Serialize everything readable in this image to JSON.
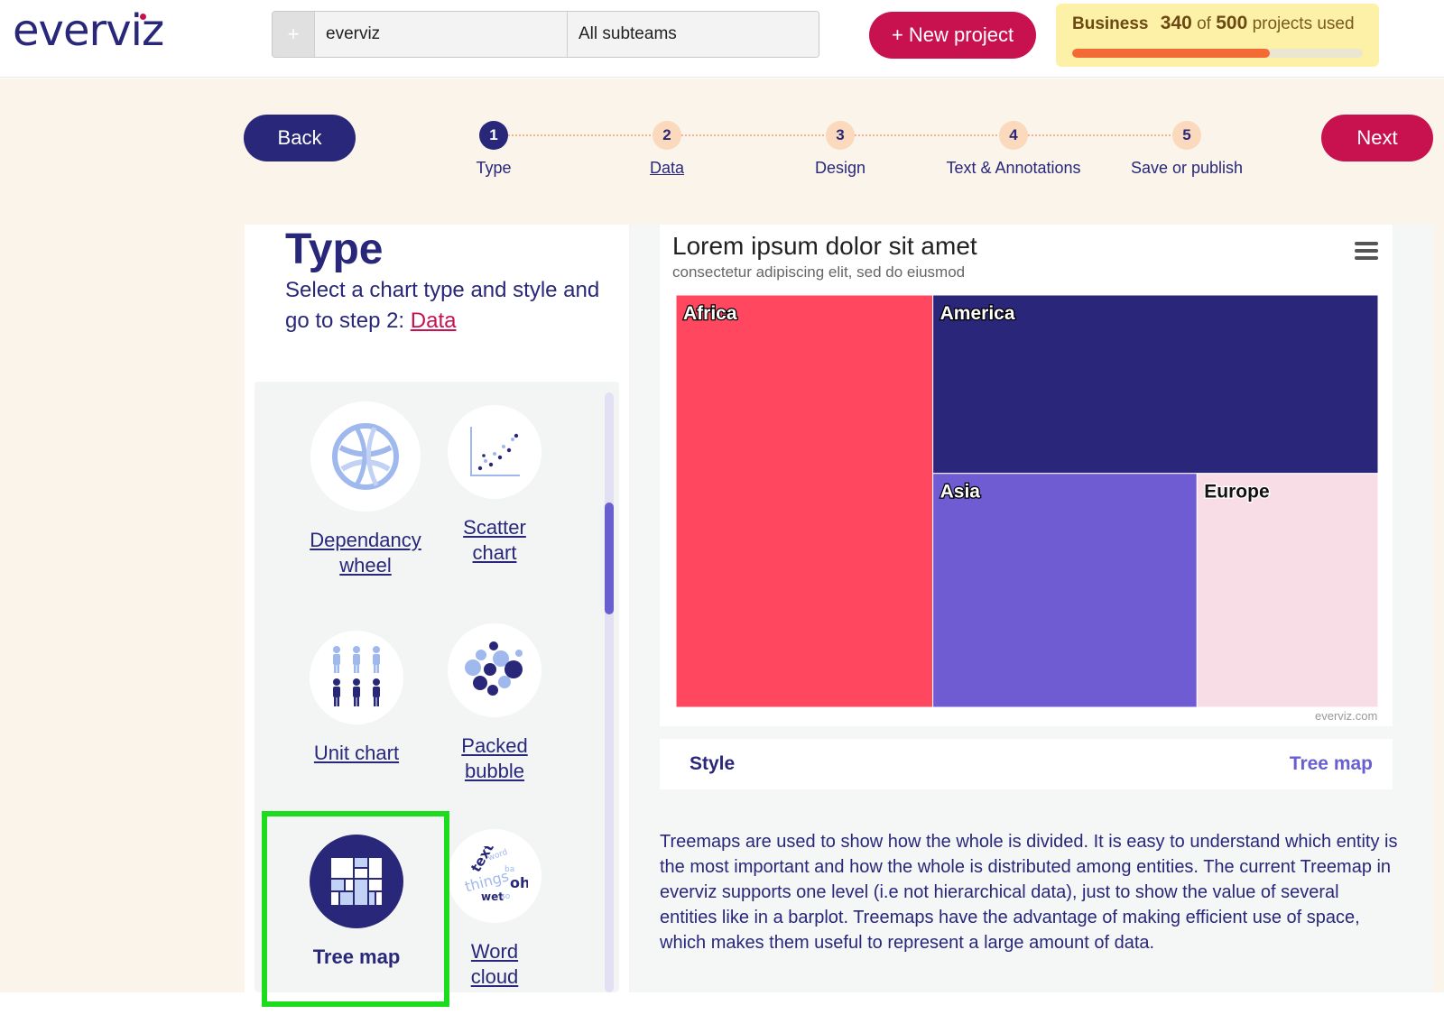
{
  "header": {
    "logo": "everviz",
    "search_plus": "+",
    "search_value": "everviz",
    "subteam": "All subteams",
    "new_project": "+ New project",
    "plan": {
      "name": "Business",
      "used": "340",
      "of_label": "of",
      "total": "500",
      "suffix": "projects used",
      "usage_fraction": 0.68,
      "bar_color": "#f46a35"
    }
  },
  "nav": {
    "back": "Back",
    "next": "Next"
  },
  "steps": [
    {
      "number": "1",
      "label": "Type",
      "state": "active"
    },
    {
      "number": "2",
      "label": "Data",
      "state": "link"
    },
    {
      "number": "3",
      "label": "Design",
      "state": "default"
    },
    {
      "number": "4",
      "label": "Text & Annotations",
      "state": "default"
    },
    {
      "number": "5",
      "label": "Save or publish",
      "state": "default"
    }
  ],
  "type_panel": {
    "title": "Type",
    "subtitle": "Select a chart type and style and go to step 2:",
    "subtitle_link": "Data",
    "chart_types": [
      {
        "id": "dependency-wheel",
        "label": "Dependancy wheel",
        "icon": "dependency-wheel-icon",
        "selected": false
      },
      {
        "id": "scatter",
        "label": "Scatter chart",
        "icon": "scatter-chart-icon",
        "selected": false
      },
      {
        "id": "unit",
        "label": "Unit chart",
        "icon": "unit-chart-icon",
        "selected": false
      },
      {
        "id": "packed-bubble",
        "label": "Packed bubble",
        "icon": "packed-bubble-icon",
        "selected": false
      },
      {
        "id": "tree-map",
        "label": "Tree map",
        "icon": "tree-map-icon",
        "selected": true
      },
      {
        "id": "word-cloud",
        "label": "Word cloud",
        "icon": "word-cloud-icon",
        "selected": false
      }
    ]
  },
  "preview": {
    "title": "Lorem ipsum dolor sit amet",
    "subtitle": "consectetur adipiscing elit, sed do eiusmod",
    "credit": "everviz.com",
    "menu_icon": "hamburger-menu-icon"
  },
  "chart_data": {
    "type": "treemap",
    "title": "Lorem ipsum dolor sit amet",
    "subtitle": "consectetur adipiscing elit, sed do eiusmod",
    "points": [
      {
        "name": "Africa",
        "value": 6,
        "color": "#ff475f"
      },
      {
        "name": "America",
        "value": 4.5,
        "color": "#2a267a"
      },
      {
        "name": "Asia",
        "value": 3.5,
        "color": "#6f5bd2"
      },
      {
        "name": "Europe",
        "value": 2.4,
        "color": "#f9dde6"
      }
    ]
  },
  "style_row": {
    "label": "Style",
    "value": "Tree map"
  },
  "description": "Treemaps are used to show how the whole is divided. It is easy to understand which entity is the most important and how the whole is distributed among entities. The current Treemap in everviz supports one level (i.e not hierarchical data), just to show the value of several entities like in a barplot. Treemaps have the advantage of making efficient use of space, which makes them useful to represent a large amount of data.",
  "colors": {
    "navy": "#28277a",
    "crimson": "#c8124f",
    "beige": "#faf4ea",
    "selection": "#1ddc1d"
  }
}
